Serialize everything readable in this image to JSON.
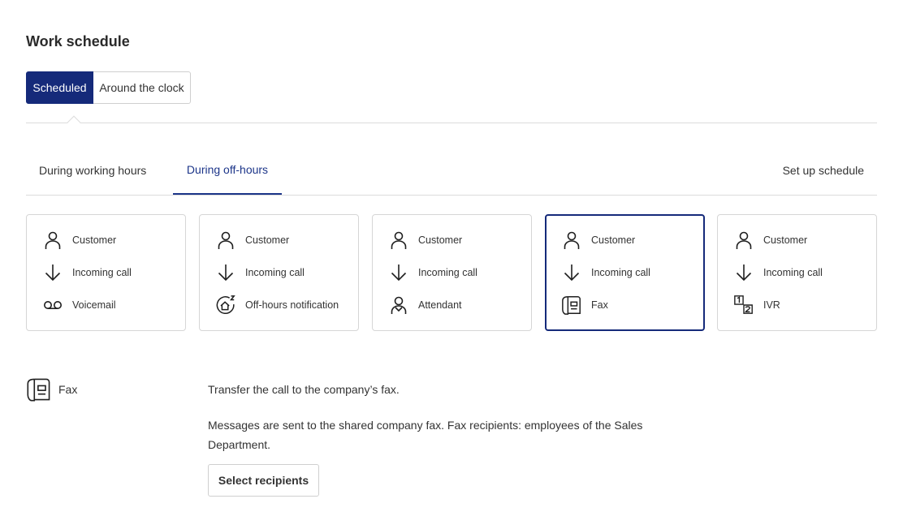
{
  "header": {
    "title": "Work schedule"
  },
  "schedule_toggle": {
    "options": [
      "Scheduled",
      "Around the clock"
    ],
    "selected": "Scheduled"
  },
  "tabs": {
    "items": [
      "During working hours",
      "During off-hours"
    ],
    "selected": "During off-hours",
    "action": "Set up schedule"
  },
  "cards": [
    {
      "rows": [
        {
          "icon": "person-icon",
          "label": "Customer"
        },
        {
          "icon": "arrow-down-icon",
          "label": "Incoming call"
        },
        {
          "icon": "voicemail-icon",
          "label": "Voicemail"
        }
      ],
      "selected": false
    },
    {
      "rows": [
        {
          "icon": "person-icon",
          "label": "Customer"
        },
        {
          "icon": "arrow-down-icon",
          "label": "Incoming call"
        },
        {
          "icon": "off-hours-notification-icon",
          "label": "Off-hours notification"
        }
      ],
      "selected": false
    },
    {
      "rows": [
        {
          "icon": "person-icon",
          "label": "Customer"
        },
        {
          "icon": "arrow-down-icon",
          "label": "Incoming call"
        },
        {
          "icon": "attendant-icon",
          "label": "Attendant"
        }
      ],
      "selected": false
    },
    {
      "rows": [
        {
          "icon": "person-icon",
          "label": "Customer"
        },
        {
          "icon": "arrow-down-icon",
          "label": "Incoming call"
        },
        {
          "icon": "fax-icon",
          "label": "Fax"
        }
      ],
      "selected": true
    },
    {
      "rows": [
        {
          "icon": "person-icon",
          "label": "Customer"
        },
        {
          "icon": "arrow-down-icon",
          "label": "Incoming call"
        },
        {
          "icon": "ivr-icon",
          "label": "IVR"
        }
      ],
      "selected": false
    }
  ],
  "detail": {
    "icon": "fax-icon",
    "label": "Fax",
    "description": "Transfer the call to the company’s fax.",
    "note": "Messages are sent to the shared company fax. Fax recipients: employees of the Sales Department.",
    "button": "Select recipients"
  },
  "colors": {
    "accent": "#152a7a",
    "border": "#d6d6d6",
    "text": "#333333"
  }
}
